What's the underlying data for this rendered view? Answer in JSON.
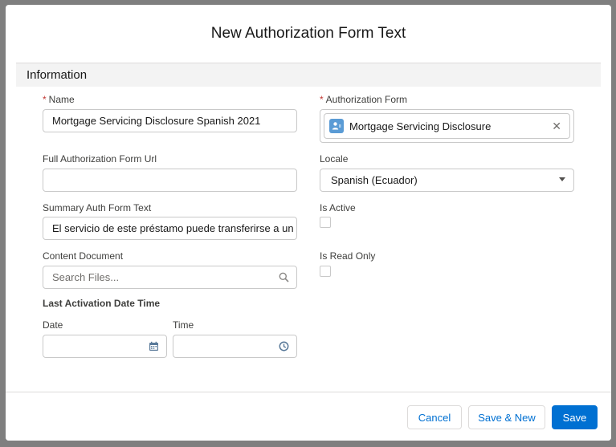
{
  "modal": {
    "title": "New Authorization Form Text"
  },
  "section": {
    "title": "Information"
  },
  "fields": {
    "name": {
      "label": "Name",
      "required": true,
      "value": "Mortgage Servicing Disclosure Spanish 2021"
    },
    "auth_form": {
      "label": "Authorization Form",
      "required": true,
      "value": "Mortgage Servicing Disclosure",
      "close_glyph": "✕"
    },
    "full_url": {
      "label": "Full Authorization Form Url",
      "value": ""
    },
    "locale": {
      "label": "Locale",
      "value": "Spanish (Ecuador)"
    },
    "summary": {
      "label": "Summary Auth Form Text",
      "value": "El servicio de este préstamo puede transferirse a un"
    },
    "is_active": {
      "label": "Is Active",
      "checked": false
    },
    "content_doc": {
      "label": "Content Document",
      "placeholder": "Search Files..."
    },
    "is_read_only": {
      "label": "Is Read Only",
      "checked": false
    },
    "last_activation": {
      "label": "Last Activation Date Time"
    },
    "date": {
      "label": "Date",
      "value": ""
    },
    "time": {
      "label": "Time",
      "value": ""
    }
  },
  "footer": {
    "cancel": "Cancel",
    "save_new": "Save & New",
    "save": "Save"
  },
  "required_mark": "*",
  "icons": {
    "lookup": "contact-icon",
    "search": "search-icon",
    "calendar": "calendar-icon",
    "clock": "clock-icon",
    "caret": "chevron-down-icon"
  },
  "colors": {
    "brand": "#0070d2",
    "required": "#c23934",
    "badge": "#5a9bd5"
  }
}
